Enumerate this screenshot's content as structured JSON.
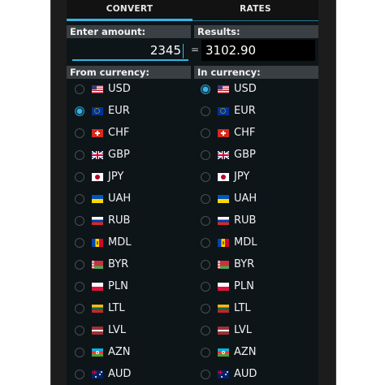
{
  "tabs": [
    {
      "label": "CONVERT",
      "active": true
    },
    {
      "label": "RATES",
      "active": false
    }
  ],
  "amount": {
    "label": "Enter amount:",
    "value": "2345"
  },
  "equals": "=",
  "results": {
    "label": "Results:",
    "value": "3102.90"
  },
  "from_currency": {
    "label": "From currency:",
    "selected": "EUR",
    "items": [
      {
        "code": "USD",
        "flag": "us-flag-icon",
        "checked": false
      },
      {
        "code": "EUR",
        "flag": "eu-flag-icon",
        "checked": true
      },
      {
        "code": "CHF",
        "flag": "ch-flag-icon",
        "checked": false
      },
      {
        "code": "GBP",
        "flag": "gb-flag-icon",
        "checked": false
      },
      {
        "code": "JPY",
        "flag": "jp-flag-icon",
        "checked": false
      },
      {
        "code": "UAH",
        "flag": "ua-flag-icon",
        "checked": false
      },
      {
        "code": "RUB",
        "flag": "ru-flag-icon",
        "checked": false
      },
      {
        "code": "MDL",
        "flag": "md-flag-icon",
        "checked": false
      },
      {
        "code": "BYR",
        "flag": "by-flag-icon",
        "checked": false
      },
      {
        "code": "PLN",
        "flag": "pl-flag-icon",
        "checked": false
      },
      {
        "code": "LTL",
        "flag": "lt-flag-icon",
        "checked": false
      },
      {
        "code": "LVL",
        "flag": "lv-flag-icon",
        "checked": false
      },
      {
        "code": "AZN",
        "flag": "az-flag-icon",
        "checked": false
      },
      {
        "code": "AUD",
        "flag": "au-flag-icon",
        "checked": false
      }
    ]
  },
  "in_currency": {
    "label": "In currency:",
    "selected": "USD",
    "items": [
      {
        "code": "USD",
        "flag": "us-flag-icon",
        "checked": true
      },
      {
        "code": "EUR",
        "flag": "eu-flag-icon",
        "checked": false
      },
      {
        "code": "CHF",
        "flag": "ch-flag-icon",
        "checked": false
      },
      {
        "code": "GBP",
        "flag": "gb-flag-icon",
        "checked": false
      },
      {
        "code": "JPY",
        "flag": "jp-flag-icon",
        "checked": false
      },
      {
        "code": "UAH",
        "flag": "ua-flag-icon",
        "checked": false
      },
      {
        "code": "RUB",
        "flag": "ru-flag-icon",
        "checked": false
      },
      {
        "code": "MDL",
        "flag": "md-flag-icon",
        "checked": false
      },
      {
        "code": "BYR",
        "flag": "by-flag-icon",
        "checked": false
      },
      {
        "code": "PLN",
        "flag": "pl-flag-icon",
        "checked": false
      },
      {
        "code": "LTL",
        "flag": "lt-flag-icon",
        "checked": false
      },
      {
        "code": "LVL",
        "flag": "lv-flag-icon",
        "checked": false
      },
      {
        "code": "AZN",
        "flag": "az-flag-icon",
        "checked": false
      },
      {
        "code": "AUD",
        "flag": "au-flag-icon",
        "checked": false
      }
    ]
  },
  "colors": {
    "accent": "#33b5e5",
    "background": "#0d1519",
    "header": "#3a3f43"
  }
}
